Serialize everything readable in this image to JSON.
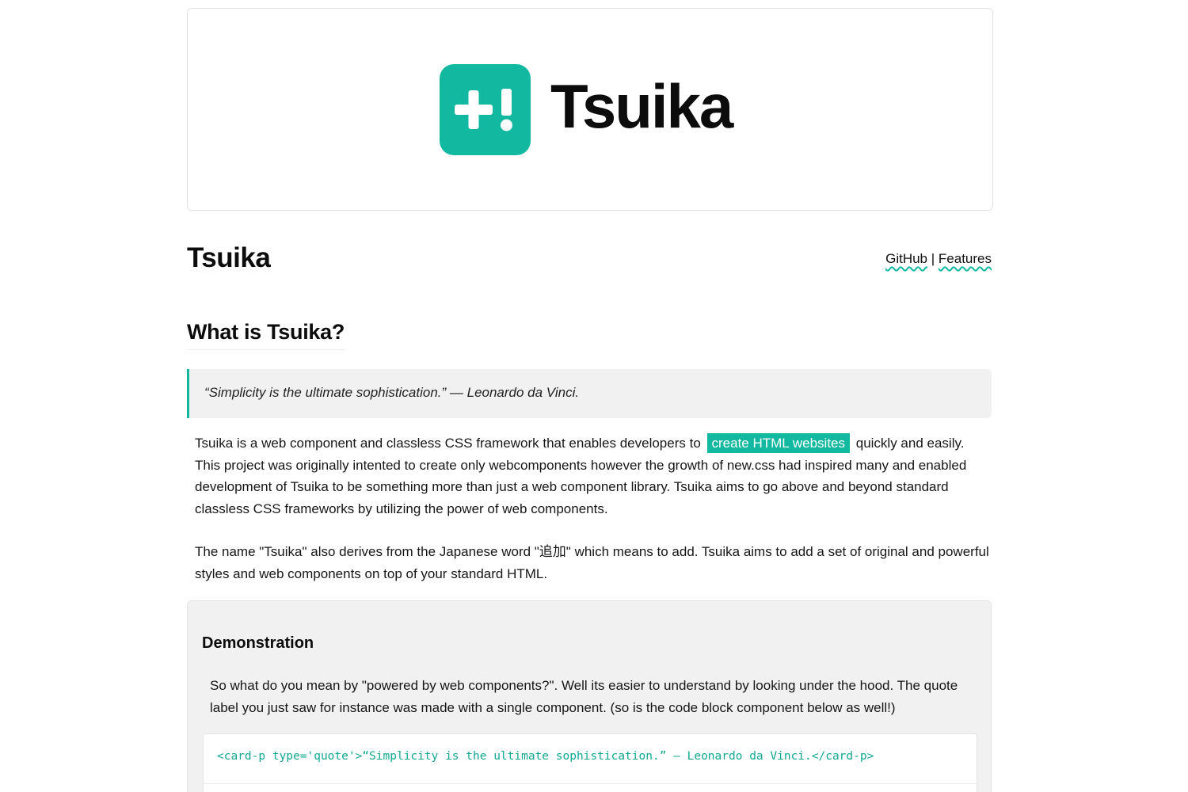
{
  "banner": {
    "logo_word": "Tsuika",
    "brand_color": "#12b9a0",
    "logo_icon": "plus-exclamation-icon"
  },
  "header": {
    "title": "Tsuika",
    "nav": {
      "github": "GitHub",
      "separator": "|",
      "features": "Features"
    }
  },
  "section": {
    "heading": "What is Tsuika?"
  },
  "quote": {
    "text": "“Simplicity is the ultimate sophistication.” — Leonardo da Vinci."
  },
  "intro": {
    "p1_before": "Tsuika is a web component and classless CSS framework that enables developers to",
    "p1_highlight": "create HTML websites",
    "p1_after": "quickly and easily. This project was originally intented to create only webcomponents however the growth of new.css had inspired many and enabled development of Tsuika to be something more than just a web component library. Tsuika aims to go above and beyond standard classless CSS frameworks by utilizing the power of web components.",
    "p2": "The name \"Tsuika\" also derives from the Japanese word \"追加\" which means to add. Tsuika aims to add a set of original and powerful styles and web components on top of your standard HTML."
  },
  "demo": {
    "title": "Demonstration",
    "text": "So what do you mean by \"powered by web components?\". Well its easier to understand by looking under the hood. The quote label you just saw for instance was made with a single component. (so is the code block component below as well!)",
    "code": "<card-p type='quote'>“Simplicity is the ultimate sophistication.” — Leonardo da Vinci.</card-p>"
  }
}
